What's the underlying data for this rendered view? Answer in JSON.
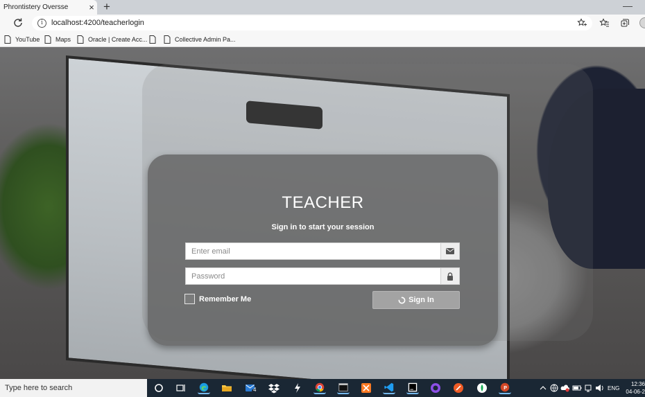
{
  "browser": {
    "tab_title": "Phrontistery Oversse",
    "tab_close": "×",
    "new_tab": "+",
    "minimize": "—",
    "url": "localhost:4200/teacherlogin",
    "bookmarks": [
      {
        "label": "YouTube"
      },
      {
        "label": "Maps"
      },
      {
        "label": "Oracle | Create Acc..."
      },
      {
        "label": ""
      },
      {
        "label": "Collective Admin Pa..."
      }
    ]
  },
  "login": {
    "title": "TEACHER",
    "subtitle": "Sign in to start your session",
    "email_placeholder": "Enter email",
    "email_value": "",
    "password_placeholder": "Password",
    "password_value": "",
    "remember_label": "Remember Me",
    "signin_label": "Sign In"
  },
  "taskbar": {
    "search_placeholder": "Type here to search",
    "mail_badge": "4",
    "language": "ENG",
    "time": "12:36",
    "date": "04-06-2"
  },
  "colors": {
    "card": "#5f5f5f",
    "signin_button": "#a3a3a3",
    "taskbar": "#1a2734"
  }
}
